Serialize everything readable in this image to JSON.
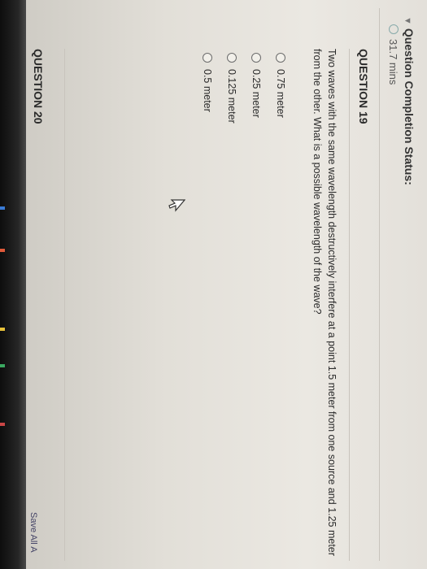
{
  "header": {
    "title": "Question Completion Status:",
    "timer": "31.7 mins"
  },
  "question_19": {
    "heading": "QUESTION 19",
    "prompt": "Two waves with the same wavelength destructively interfere at a point 1.5 meter from one source and 1.25 meter from the other. What is a possible wavelength of the wave?",
    "options": [
      "0.75 meter",
      "0.25 meter",
      "0.125 meter",
      "0.5 meter"
    ]
  },
  "question_20": {
    "heading": "QUESTION 20"
  },
  "footer": {
    "save_all": "Save All A"
  },
  "colors": {
    "background": "#e6e3dc",
    "text": "#2b2b2b",
    "bezel": "#1a1a1a"
  }
}
